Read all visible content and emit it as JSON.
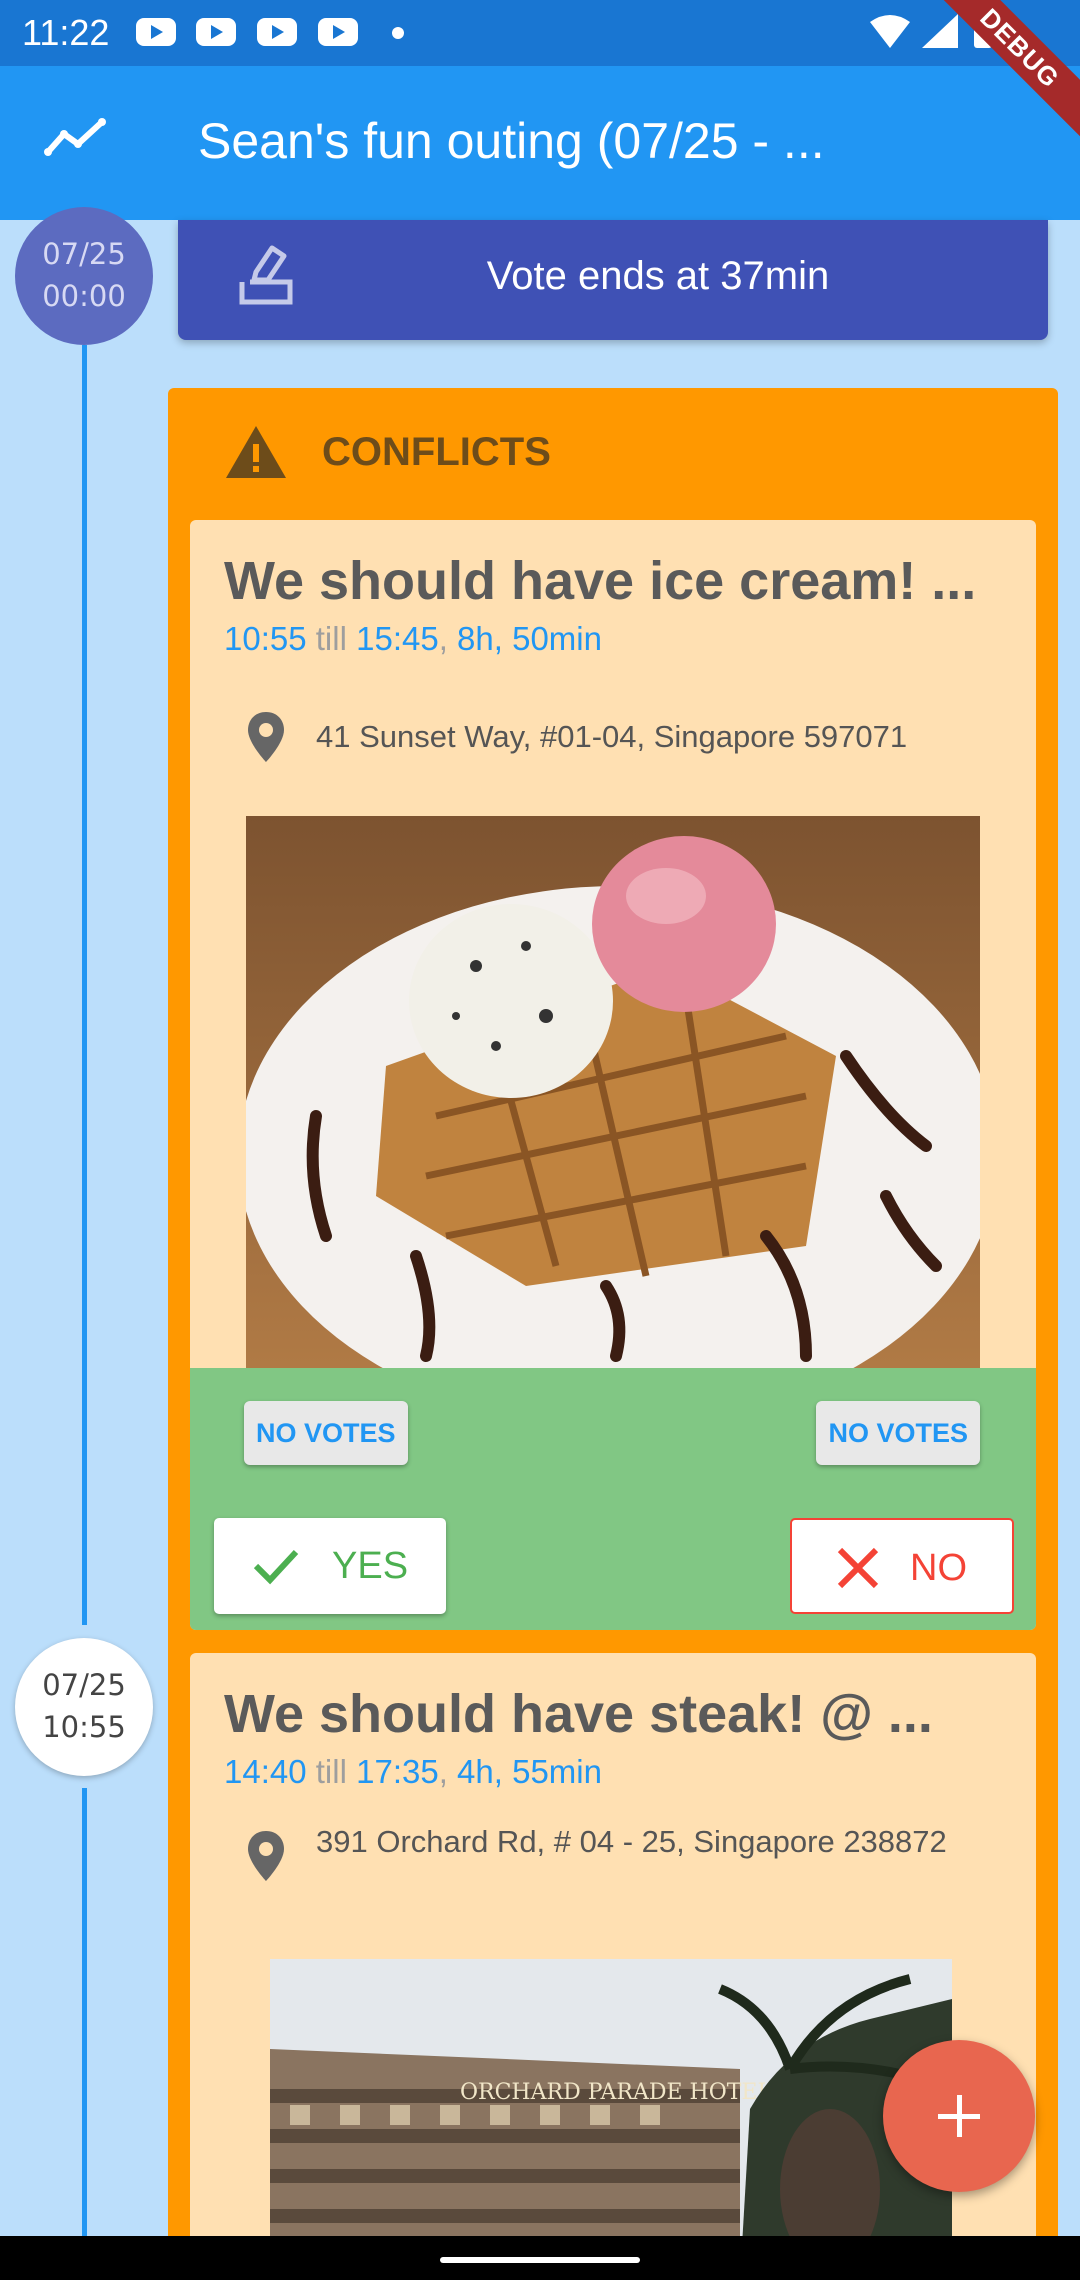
{
  "status_bar": {
    "time": "11:22"
  },
  "app_bar": {
    "title": "Sean's fun outing (07/25 - ...",
    "debug_label": "DEBUG"
  },
  "timeline": {
    "markers": [
      {
        "date": "07/25",
        "time": "00:00"
      },
      {
        "date": "07/25",
        "time": "10:55"
      }
    ]
  },
  "vote_banner": {
    "text": "Vote ends at 37min"
  },
  "conflicts": {
    "label": "CONFLICTS",
    "cards": [
      {
        "title": "We should have ice cream!  ...",
        "start": "10:55",
        "till": "till",
        "end": "15:45",
        "sep": ",",
        "duration": "8h, 50min",
        "address": "41 Sunset Way, #01-04, Singapore 597071",
        "yes_votes": "NO VOTES",
        "no_votes": "NO VOTES",
        "yes_label": "YES",
        "no_label": "NO"
      },
      {
        "title": "We should have steak! @ ...",
        "start": "14:40",
        "till": "till",
        "end": "17:35",
        "sep": ",",
        "duration": "4h, 55min",
        "address": "391 Orchard Rd, # 04 - 25, Singapore 238872",
        "sign_text": "ORCHARD PARADE HOTEL"
      }
    ]
  },
  "colors": {
    "status_bar": "#1976d2",
    "app_bar": "#2196f3",
    "vote_banner": "#3f51b5",
    "conflicts_panel": "#ff9800",
    "card": "#ffe0b2",
    "vote_area": "#81c784",
    "fab": "#e8664f"
  },
  "icons": [
    "timeline-icon",
    "vote-icon",
    "warning-icon",
    "location-pin-icon",
    "check-icon",
    "close-icon",
    "add-icon"
  ]
}
